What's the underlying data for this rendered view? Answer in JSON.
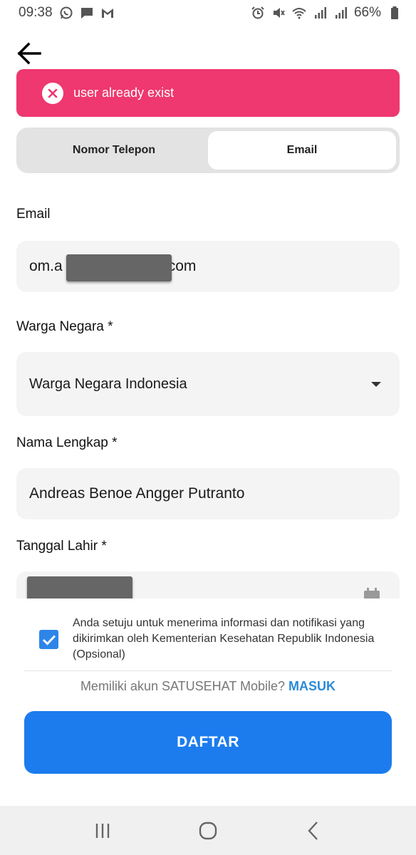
{
  "status_bar": {
    "time": "09:38",
    "battery": "66%",
    "left_icons": [
      "whatsapp-icon",
      "message-icon",
      "gmail-icon"
    ],
    "right_icons": [
      "alarm-icon",
      "mute-icon",
      "wifi-icon",
      "signal-icon",
      "signal-icon",
      "battery-icon"
    ]
  },
  "toast": {
    "message": "user already exist",
    "color": "#ee386f"
  },
  "tabs": [
    {
      "label": "Nomor Telepon",
      "active": false
    },
    {
      "label": "Email",
      "active": true
    }
  ],
  "form": {
    "email": {
      "label": "Email",
      "value_start": "om.a",
      "value_end": "com"
    },
    "citizenship": {
      "label": "Warga Negara *",
      "value": "Warga Negara Indonesia"
    },
    "full_name": {
      "label": "Nama Lengkap *",
      "value": "Andreas Benoe Angger Putranto"
    },
    "birth_date": {
      "label": "Tanggal Lahir *"
    }
  },
  "consent": {
    "text": "Anda setuju untuk menerima informasi dan notifikasi yang dikirimkan oleh Kementerian Kesehatan Republik Indonesia (Opsional)",
    "checked": true
  },
  "login_prompt": {
    "text": "Memiliki akun SATUSEHAT Mobile?",
    "link": "MASUK"
  },
  "submit": {
    "label": "DAFTAR",
    "color": "#1c7cee"
  },
  "nav_bar": {
    "buttons": [
      "recent-apps-icon",
      "home-icon",
      "back-nav-icon"
    ]
  }
}
